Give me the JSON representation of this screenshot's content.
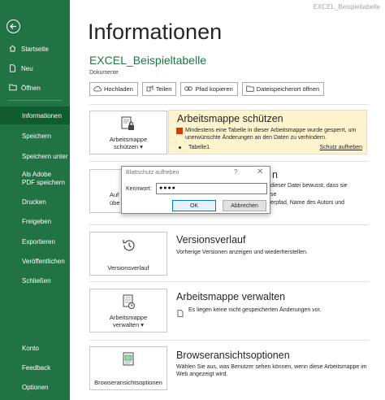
{
  "app": {
    "window_title": "EXCEL_Beispieltabelle"
  },
  "sidebar": {
    "items": [
      {
        "label": "Startseite"
      },
      {
        "label": "Neu"
      },
      {
        "label": "Öffnen"
      },
      {
        "label": "Informationen"
      },
      {
        "label": "Speichern"
      },
      {
        "label": "Speichern unter"
      },
      {
        "label": "Als Adobe PDF speichern"
      },
      {
        "label": "Drucken"
      },
      {
        "label": "Freigeben"
      },
      {
        "label": "Exportieren"
      },
      {
        "label": "Veröffentlichen"
      },
      {
        "label": "Schließen"
      },
      {
        "label": "Konto"
      },
      {
        "label": "Feedback"
      },
      {
        "label": "Optionen"
      }
    ],
    "accent_color": "#217346",
    "active_color": "#0e5c2f"
  },
  "main": {
    "title": "Informationen",
    "file_name": "EXCEL_Beispieltabelle",
    "file_location": "Dokumente",
    "toolbar": {
      "upload": "Hochladen",
      "share": "Teilen",
      "copy_path": "Pfad kopieren",
      "open_location": "Dateispeicherort öffnen"
    },
    "protect": {
      "button_line1": "Arbeitsmappe",
      "button_line2": "schützen",
      "title": "Arbeitsmappe schützen",
      "message": "Mindestens eine Tabelle in dieser Arbeitsmappe wurde gesperrt, um unerwünschte Änderungen an den Daten zu verhindern.",
      "sheet": "Tabelle1",
      "unprotect_link": "Schutz aufheben",
      "highlight_color": "#fff4ce"
    },
    "inspect": {
      "button_line1_partial": "Auf",
      "button_line2_partial": "übe",
      "title_partial": "n",
      "text_line1_partial": "dieser Datei bewusst, dass sie",
      "text_line2_partial": "se",
      "text_line3_partial": "erpfad, Name des Autors und"
    },
    "versions": {
      "button": "Versionsverlauf",
      "title": "Versionsverlauf",
      "text": "Vorherige Versionen anzeigen und wiederherstellen."
    },
    "manage": {
      "button_line1": "Arbeitsmappe",
      "button_line2": "verwalten",
      "title": "Arbeitsmappe verwalten",
      "text": "Es liegen keine nicht gespeicherten Änderungen vor."
    },
    "browser": {
      "button": "Browseransichtsoptionen",
      "title": "Browseransichtsoptionen",
      "text": "Wählen Sie aus, was Benutzer sehen können, wenn diese Arbeitsmappe im Web angezeigt wird."
    }
  },
  "dialog": {
    "title": "Blattschutz aufheben",
    "help": "?",
    "close": "✕",
    "password_label": "Kennwort:",
    "password_value": "●●●●",
    "ok": "OK",
    "cancel": "Abbrechen"
  }
}
